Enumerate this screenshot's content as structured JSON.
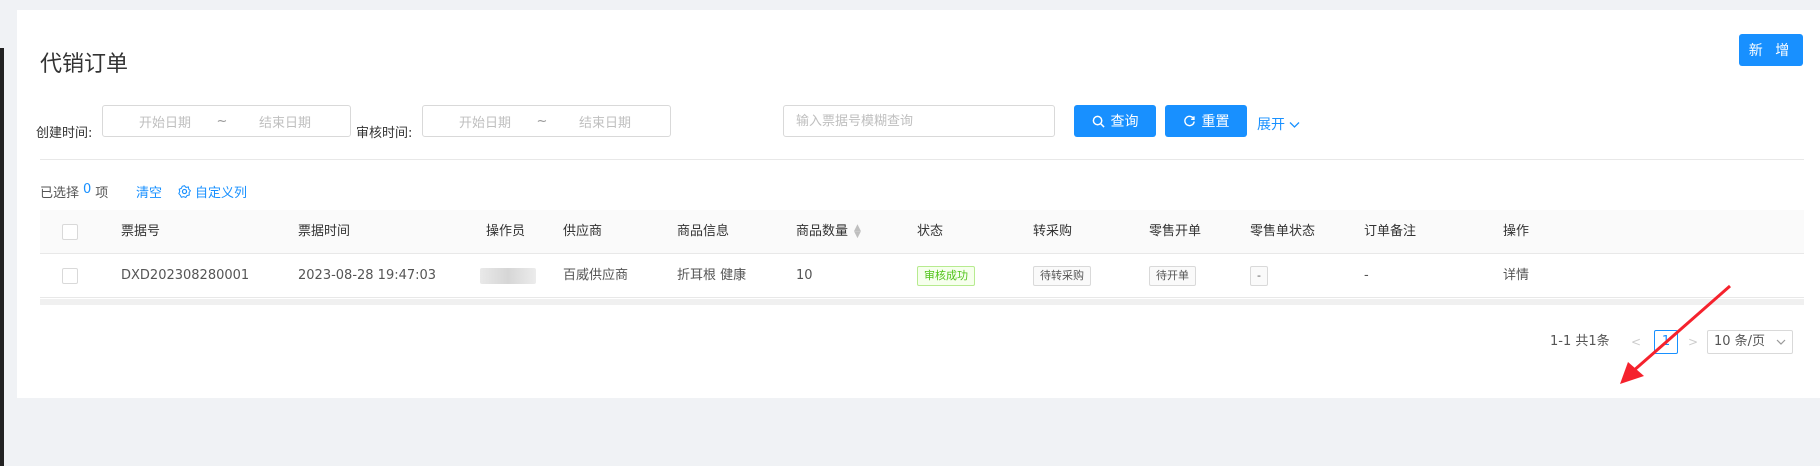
{
  "page": {
    "title": "代销订单",
    "add_label": "新 增"
  },
  "filters": {
    "create_time_label": "创建时间:",
    "create_start_placeholder": "开始日期",
    "create_end_placeholder": "结束日期",
    "audit_time_label": "审核时间:",
    "audit_start_placeholder": "开始日期",
    "audit_end_placeholder": "结束日期",
    "range_separator": "~",
    "search_placeholder": "输入票据号模糊查询",
    "query_label": "查询",
    "reset_label": "重置",
    "expand_label": "展开"
  },
  "selection": {
    "prefix": "已选择",
    "count": "0",
    "suffix": "项",
    "clear_label": "清空",
    "custom_columns_label": "自定义列"
  },
  "table": {
    "columns": [
      "票据号",
      "票据时间",
      "操作员",
      "供应商",
      "商品信息",
      "商品数量",
      "状态",
      "转采购",
      "零售开单",
      "零售单状态",
      "订单备注",
      "操作"
    ],
    "rows": [
      {
        "bill_no": "DXD202308280001",
        "bill_time": "2023-08-28 19:47:03",
        "supplier": "百威供应商",
        "product_info": "折耳根 健康",
        "quantity": "10",
        "status": "审核成功",
        "to_purchase": "待转采购",
        "retail_order": "待开单",
        "retail_status": "-",
        "remark": "-",
        "action": "详情"
      }
    ]
  },
  "pagination": {
    "total_text": "1-1 共1条",
    "current_page": "1",
    "page_size": "10 条/页"
  },
  "colors": {
    "primary": "#1890ff",
    "success": "#52c41a",
    "annotation_arrow": "#f5222d"
  }
}
